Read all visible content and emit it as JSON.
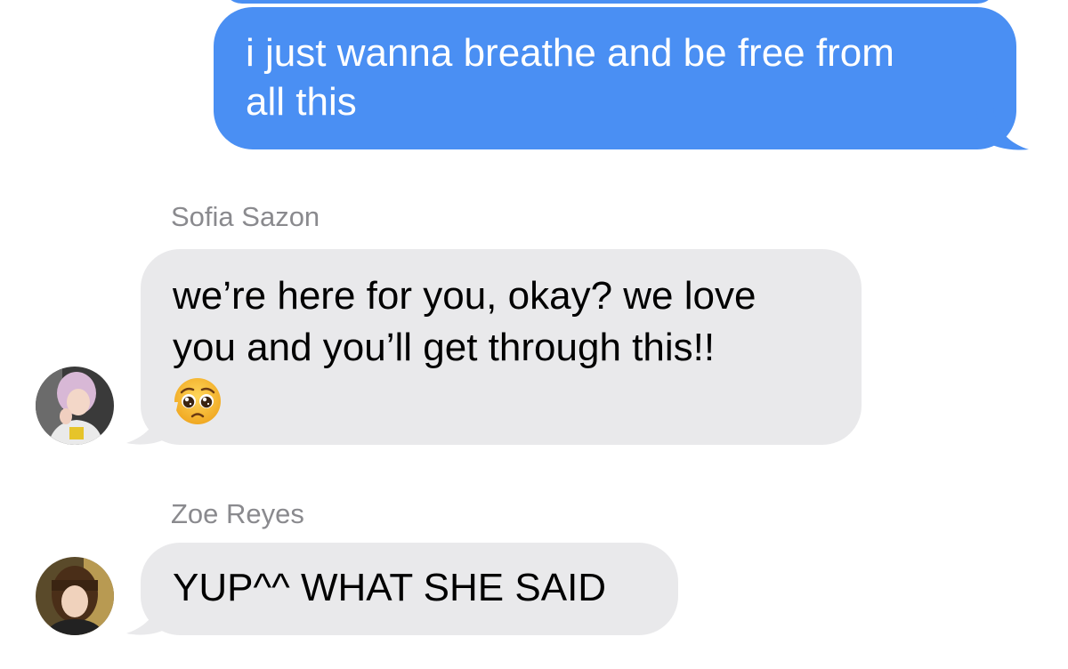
{
  "conversation": {
    "outgoing": {
      "text": "i just wanna breathe and be free from all this",
      "line1": "i just wanna breathe and be free from",
      "line2": "all this"
    },
    "messages": [
      {
        "sender": "Sofia Sazon",
        "line1": "we’re here for you, okay? we love",
        "line2": "you and you’ll get through this!!",
        "emoji": "pleading-face"
      },
      {
        "sender": "Zoe Reyes",
        "line1": "YUP^^ WHAT SHE SAID"
      }
    ]
  },
  "colors": {
    "outgoing_bubble": "#4a8ff3",
    "incoming_bubble": "#e9e9eb",
    "sender_name": "#8a8a8e"
  }
}
